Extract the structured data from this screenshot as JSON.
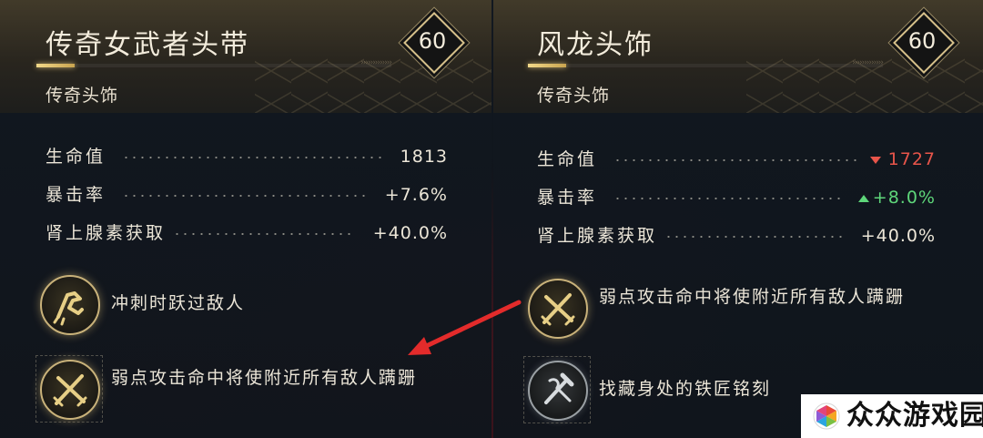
{
  "left_item": {
    "name": "传奇女武者头带",
    "rarity_type": "传奇头饰",
    "level": "60",
    "stats": [
      {
        "label": "生命值",
        "value": "1813"
      },
      {
        "label": "暴击率",
        "value": "+7.6%"
      },
      {
        "label": "肾上腺素获取",
        "value": "+40.0%"
      }
    ],
    "perks": [
      {
        "icon": "dash-leap-icon",
        "text": "冲刺时跃过敌人"
      },
      {
        "icon": "crossed-swords-icon",
        "text": "弱点攻击命中将使附近所有敌人蹒跚"
      }
    ]
  },
  "right_item": {
    "name": "风龙头饰",
    "rarity_type": "传奇头饰",
    "level": "60",
    "stats": [
      {
        "label": "生命值",
        "value": "1727",
        "change": "down"
      },
      {
        "label": "暴击率",
        "value": "+8.0%",
        "change": "up"
      },
      {
        "label": "肾上腺素获取",
        "value": "+40.0%"
      }
    ],
    "perks": [
      {
        "icon": "crossed-swords-icon",
        "text": "弱点攻击命中将使附近所有敌人蹒跚"
      },
      {
        "icon": "blacksmith-tools-icon",
        "text": "找藏身处的铁匠铭刻"
      }
    ]
  },
  "annotation": {
    "arrow_color": "#e32b2b",
    "direction": "right-perk-to-left-perk"
  },
  "watermark": {
    "text": "众众游戏园"
  },
  "colors": {
    "gold": "#d6c08a",
    "increase": "#5ed67a",
    "decrease": "#e8554a",
    "text": "#ece6d8"
  }
}
